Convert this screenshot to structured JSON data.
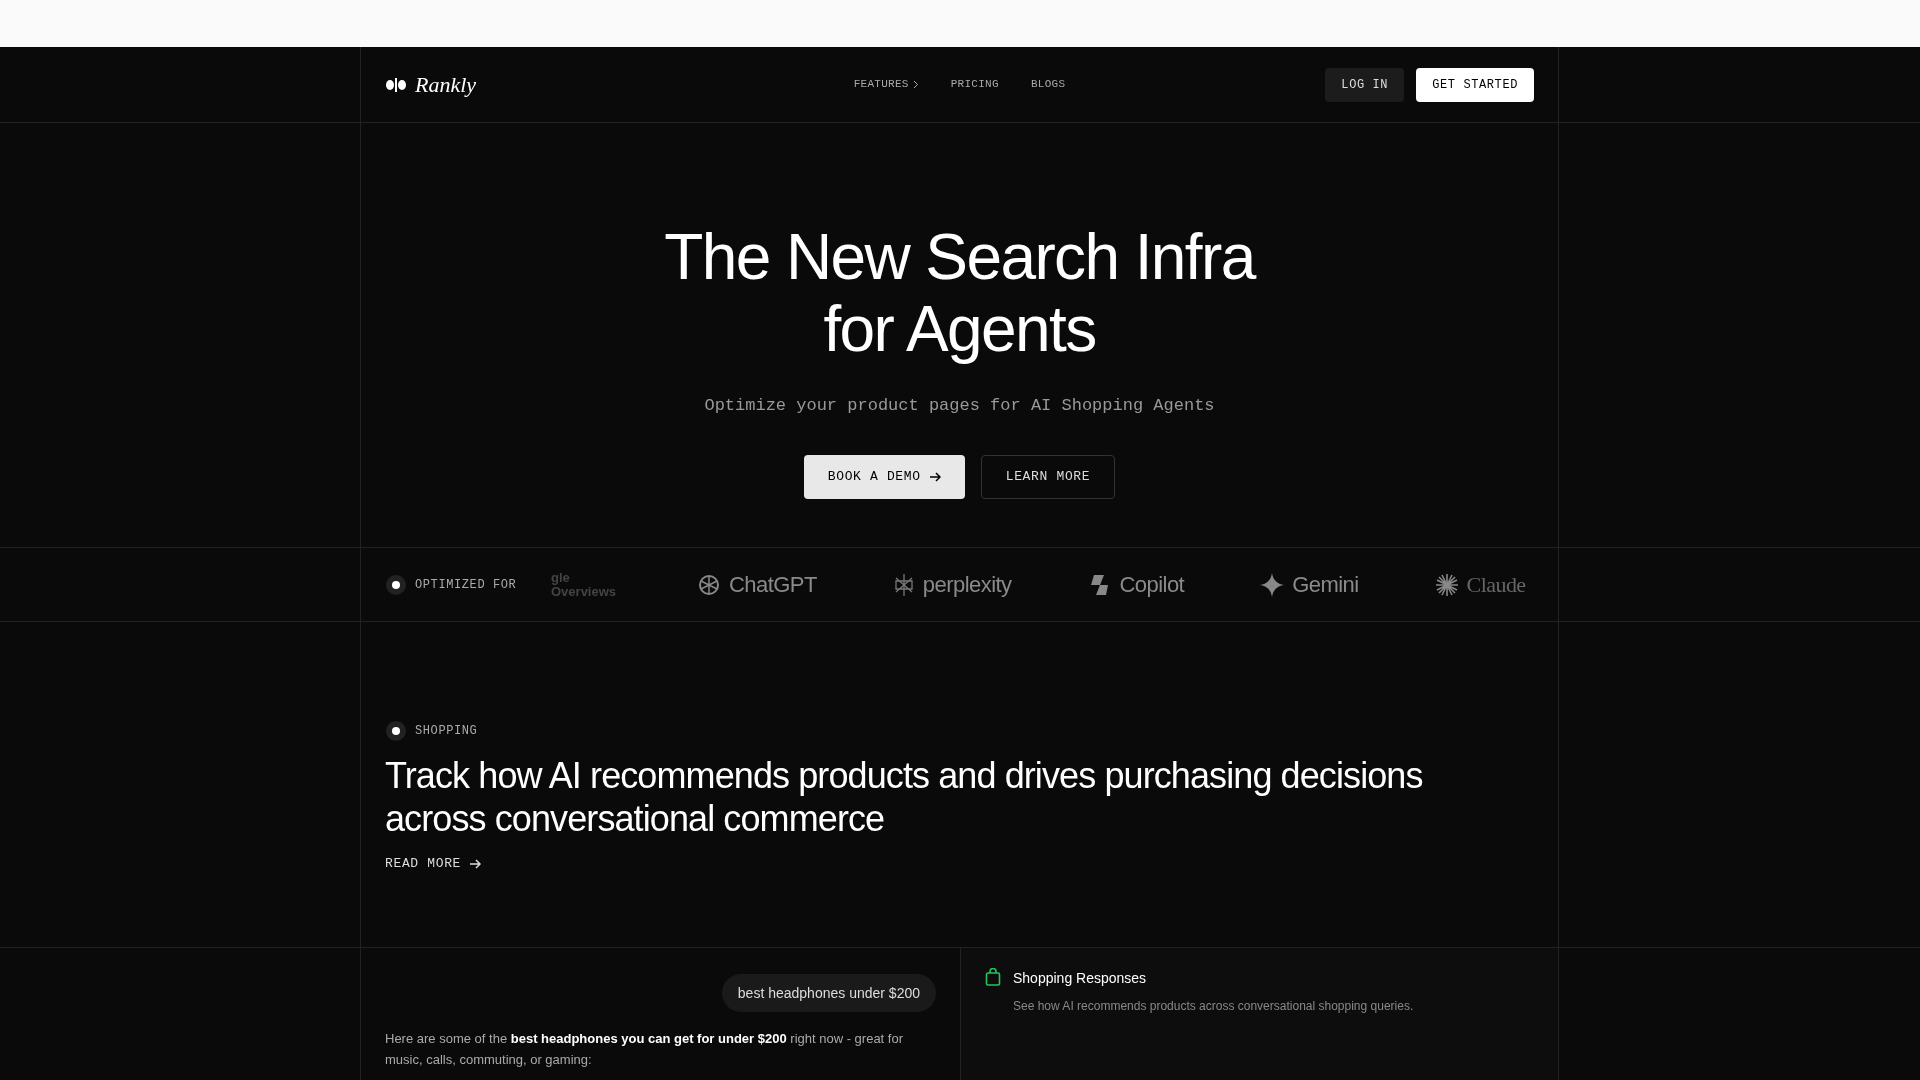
{
  "brand": "Rankly",
  "nav": [
    {
      "label": "FEATURES",
      "has_menu": true
    },
    {
      "label": "PRICING",
      "has_menu": false
    },
    {
      "label": "BLOGS",
      "has_menu": false
    }
  ],
  "header_buttons": [
    {
      "label": "LOG IN",
      "kind": "secondary"
    },
    {
      "label": "GET STARTED",
      "kind": "primary"
    }
  ],
  "hero": {
    "title_lines": [
      "The New Search Infra",
      "for Agents"
    ],
    "subtitle": "Optimize your product pages for AI Shopping Agents",
    "buttons": [
      {
        "label": "BOOK A DEMO",
        "kind": "primary"
      },
      {
        "label": "LEARN MORE",
        "kind": "secondary"
      }
    ]
  },
  "logo_strip": {
    "label": "OPTIMIZED FOR",
    "logos": [
      {
        "name": "gle Overviews",
        "kind": "text"
      },
      {
        "name": "ChatGPT",
        "kind": "knot"
      },
      {
        "name": "perplexity",
        "kind": "spark"
      },
      {
        "name": "Copilot",
        "kind": "swirl"
      },
      {
        "name": "Gemini",
        "kind": "star"
      },
      {
        "name": "Claude",
        "kind": "burst"
      }
    ]
  },
  "feature": {
    "tag": "SHOPPING",
    "heading": "Track how AI recommends products and drives purchasing decisions across conversational commerce",
    "link": "READ MORE"
  },
  "chat": {
    "query": "best headphones under $200",
    "answer": "Here are some of the **best headphones you can get for under $200** right now - great for music, calls, commuting, or gaming:"
  },
  "panel": {
    "title": "Shopping Responses",
    "description": "See how AI recommends products across conversational shopping queries."
  }
}
